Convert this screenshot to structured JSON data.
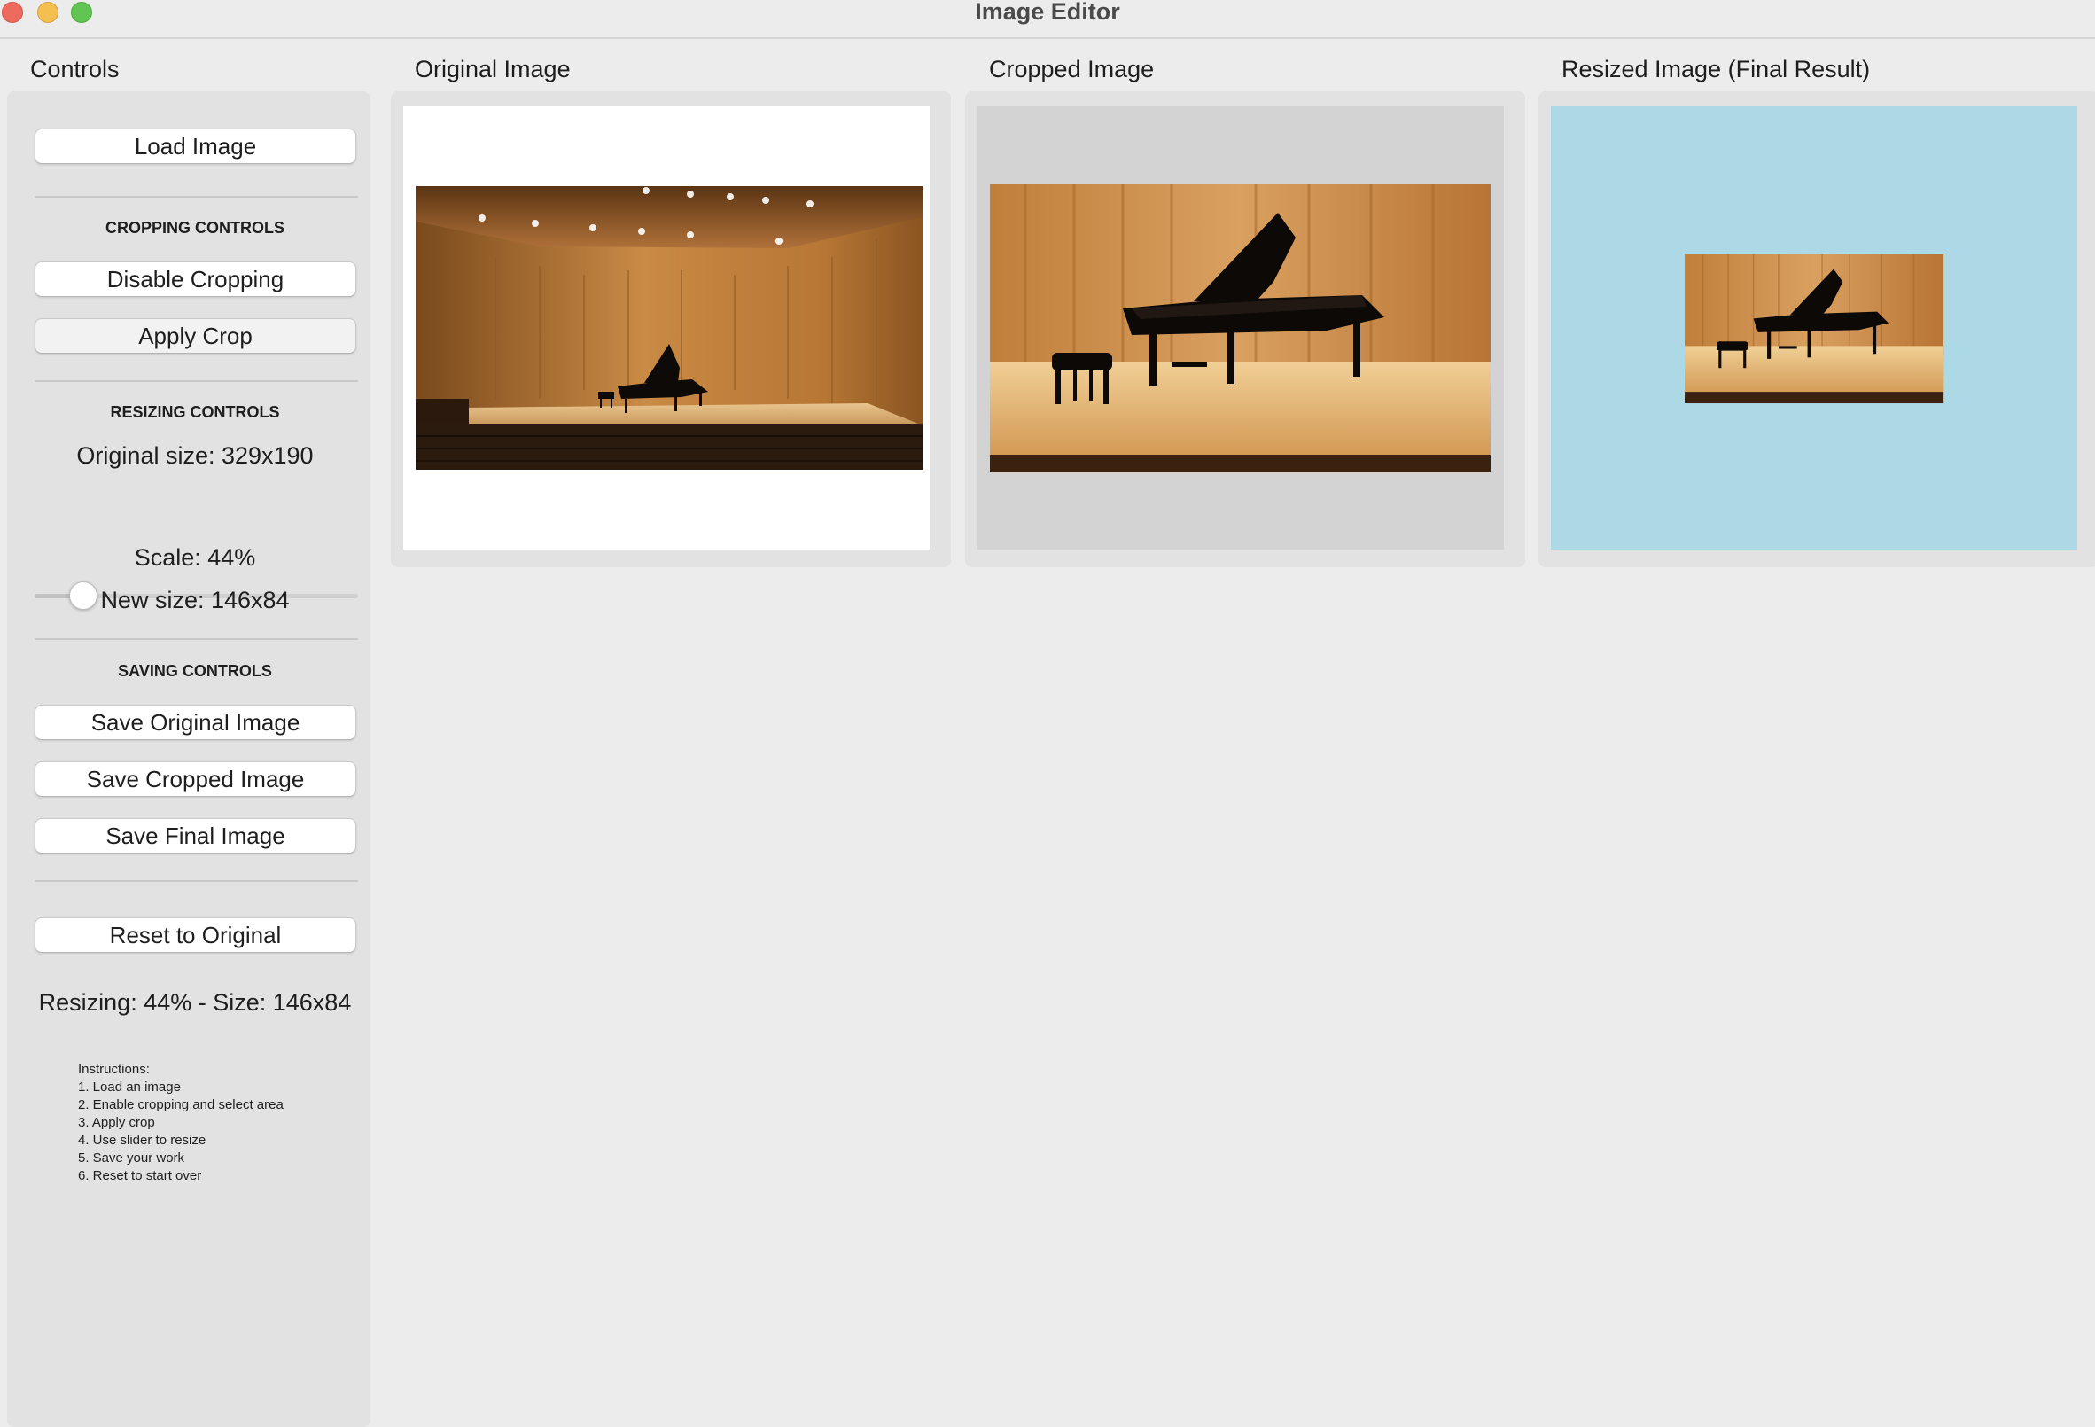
{
  "window": {
    "title": "Image Editor"
  },
  "sections": {
    "controls": "Controls",
    "original": "Original Image",
    "cropped": "Cropped Image",
    "resized": "Resized Image (Final Result)"
  },
  "controls": {
    "load_button": "Load Image",
    "cropping_header": "CROPPING CONTROLS",
    "disable_cropping_button": "Disable Cropping",
    "apply_crop_button": "Apply Crop",
    "resizing_header": "RESIZING CONTROLS",
    "original_size": "Original size: 329x190",
    "scale_slider_value": 0.44,
    "scale_label": "Scale: 44%",
    "new_size": "New size: 146x84",
    "saving_header": "SAVING CONTROLS",
    "save_original_button": "Save Original Image",
    "save_cropped_button": "Save Cropped Image",
    "save_final_button": "Save Final Image",
    "reset_button": "Reset to Original",
    "status": "Resizing: 44% - Size: 146x84",
    "instructions": "Instructions:\n1. Load an image\n2. Enable cropping and select area\n3. Apply crop\n4. Use slider to resize\n5. Save your work\n6. Reset to start over"
  },
  "colors": {
    "original_canvas_bg": "#ffffff",
    "cropped_canvas_bg": "#d3d3d3",
    "resized_canvas_bg": "#add8e6",
    "close": "#ed6a5e",
    "minimize": "#f5bf4f",
    "maximize": "#61c554"
  },
  "icons": {
    "close": "close-traffic-light",
    "minimize": "minimize-traffic-light",
    "maximize": "zoom-traffic-light"
  }
}
